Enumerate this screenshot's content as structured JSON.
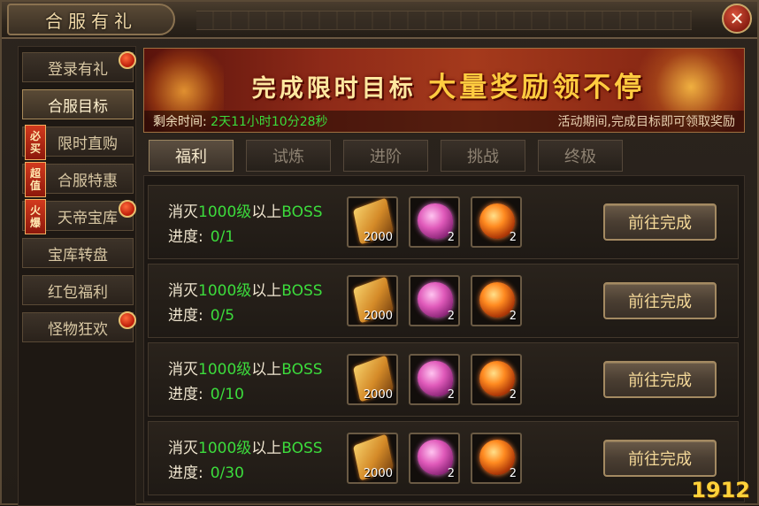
{
  "window": {
    "title": "合服有礼",
    "close_label": "✕"
  },
  "sidebar": {
    "items": [
      {
        "label": "登录有礼",
        "active": false,
        "dot": true
      },
      {
        "label": "合服目标",
        "active": true,
        "dot": false
      },
      {
        "label": "限时直购",
        "active": false,
        "dot": false,
        "tag": "必买"
      },
      {
        "label": "合服特惠",
        "active": false,
        "dot": false,
        "tag": "超值"
      },
      {
        "label": "天帝宝库",
        "active": false,
        "dot": true,
        "tag": "火爆"
      },
      {
        "label": "宝库转盘",
        "active": false,
        "dot": false
      },
      {
        "label": "红包福利",
        "active": false,
        "dot": false
      },
      {
        "label": "怪物狂欢",
        "active": false,
        "dot": true
      }
    ]
  },
  "banner": {
    "headline_part1": "完成限时目标",
    "headline_part2": "大量奖励领不停",
    "remaining_label": "剩余时间:",
    "remaining_value": "2天11小时10分28秒",
    "note": "活动期间,完成目标即可领取奖励"
  },
  "tabs": [
    {
      "label": "福利",
      "active": true
    },
    {
      "label": "试炼",
      "active": false
    },
    {
      "label": "进阶",
      "active": false
    },
    {
      "label": "挑战",
      "active": false
    },
    {
      "label": "终极",
      "active": false
    }
  ],
  "tasks": [
    {
      "prefix": "消灭",
      "level": "1000级",
      "mid": "以上",
      "target": "BOSS",
      "progress_label": "进度:",
      "progress_value": "0/1",
      "rewards": [
        {
          "icon": "gold-ticket-icon",
          "qty": "2000"
        },
        {
          "icon": "pink-gem-icon",
          "qty": "2"
        },
        {
          "icon": "fire-orb-icon",
          "qty": "2"
        }
      ],
      "button": "前往完成"
    },
    {
      "prefix": "消灭",
      "level": "1000级",
      "mid": "以上",
      "target": "BOSS",
      "progress_label": "进度:",
      "progress_value": "0/5",
      "rewards": [
        {
          "icon": "gold-ticket-icon",
          "qty": "2000"
        },
        {
          "icon": "pink-gem-icon",
          "qty": "2"
        },
        {
          "icon": "fire-orb-icon",
          "qty": "2"
        }
      ],
      "button": "前往完成"
    },
    {
      "prefix": "消灭",
      "level": "1000级",
      "mid": "以上",
      "target": "BOSS",
      "progress_label": "进度:",
      "progress_value": "0/10",
      "rewards": [
        {
          "icon": "gold-ticket-icon",
          "qty": "2000"
        },
        {
          "icon": "pink-gem-icon",
          "qty": "2"
        },
        {
          "icon": "fire-orb-icon",
          "qty": "2"
        }
      ],
      "button": "前往完成"
    },
    {
      "prefix": "消灭",
      "level": "1000级",
      "mid": "以上",
      "target": "BOSS",
      "progress_label": "进度:",
      "progress_value": "0/30",
      "rewards": [
        {
          "icon": "gold-ticket-icon",
          "qty": "2000"
        },
        {
          "icon": "pink-gem-icon",
          "qty": "2"
        },
        {
          "icon": "fire-orb-icon",
          "qty": "2"
        }
      ],
      "button": "前往完成"
    }
  ],
  "watermark": "1912"
}
